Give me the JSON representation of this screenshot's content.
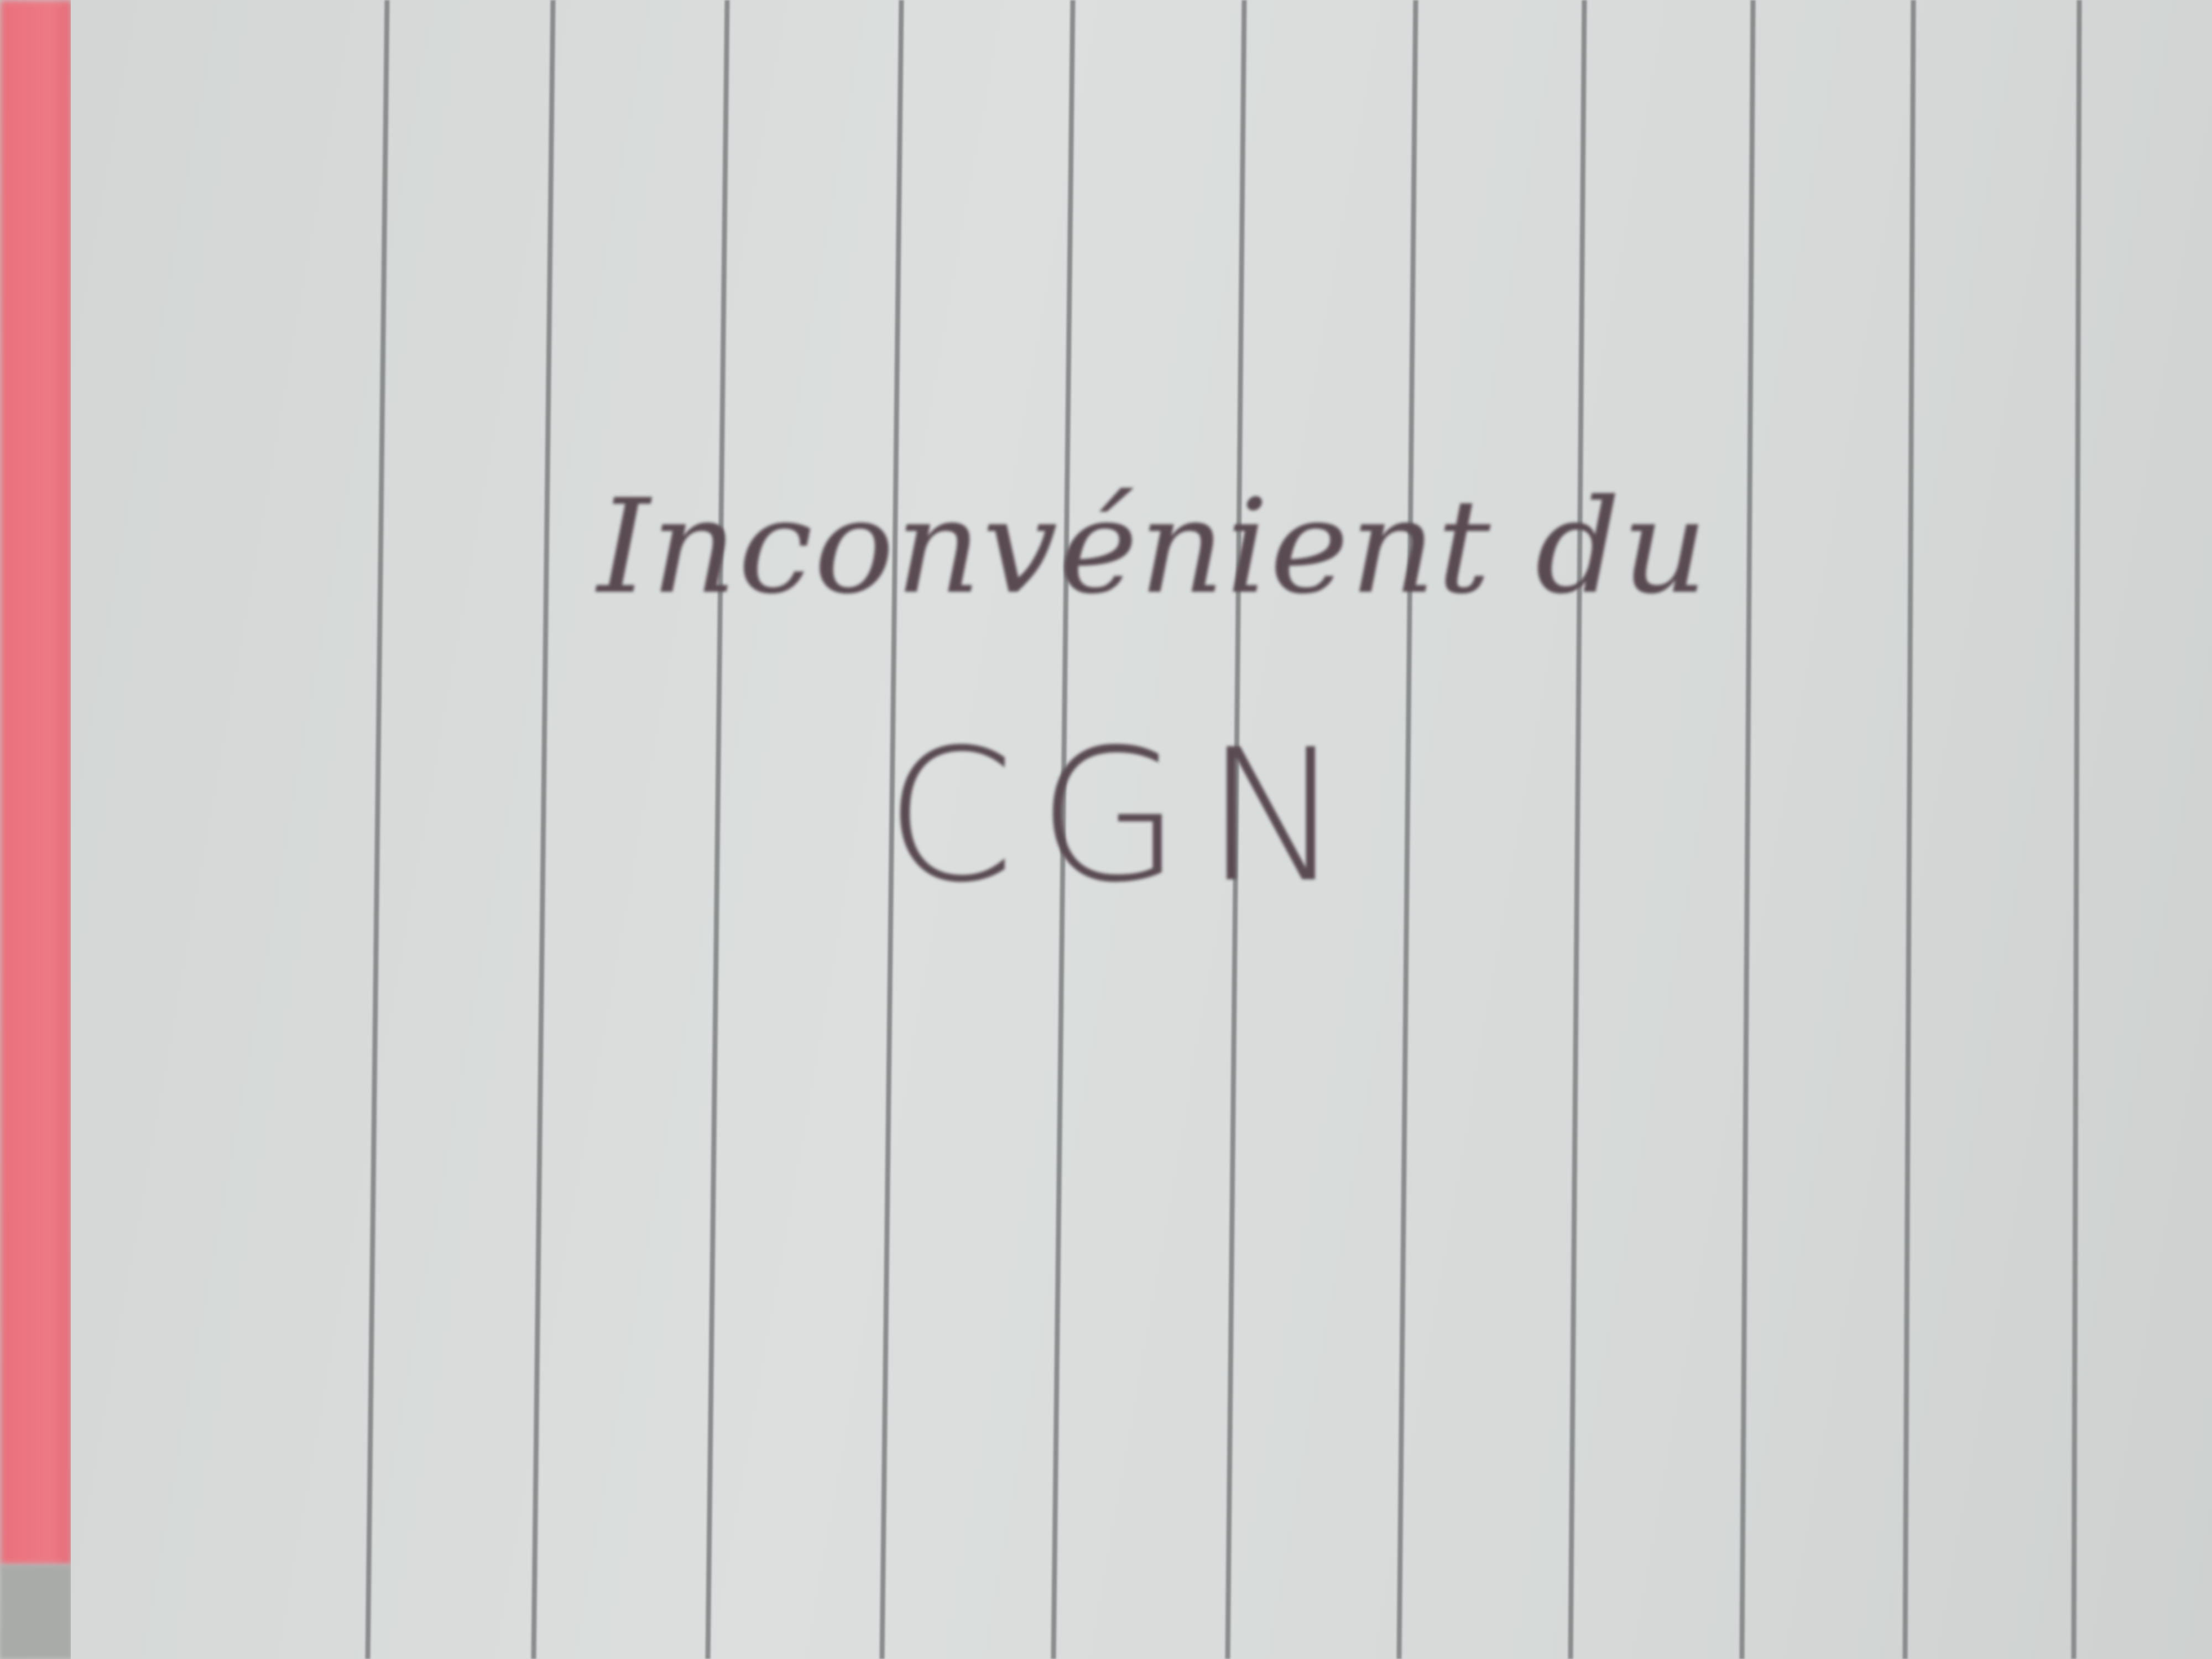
{
  "note": {
    "line1": "Inconvénient du",
    "line2": "CGN"
  },
  "colors": {
    "paper": "#d9dcdb",
    "rule_lines": "#8a8c8d",
    "ink": "#5a4b52",
    "red_cover": "#ec7884"
  }
}
